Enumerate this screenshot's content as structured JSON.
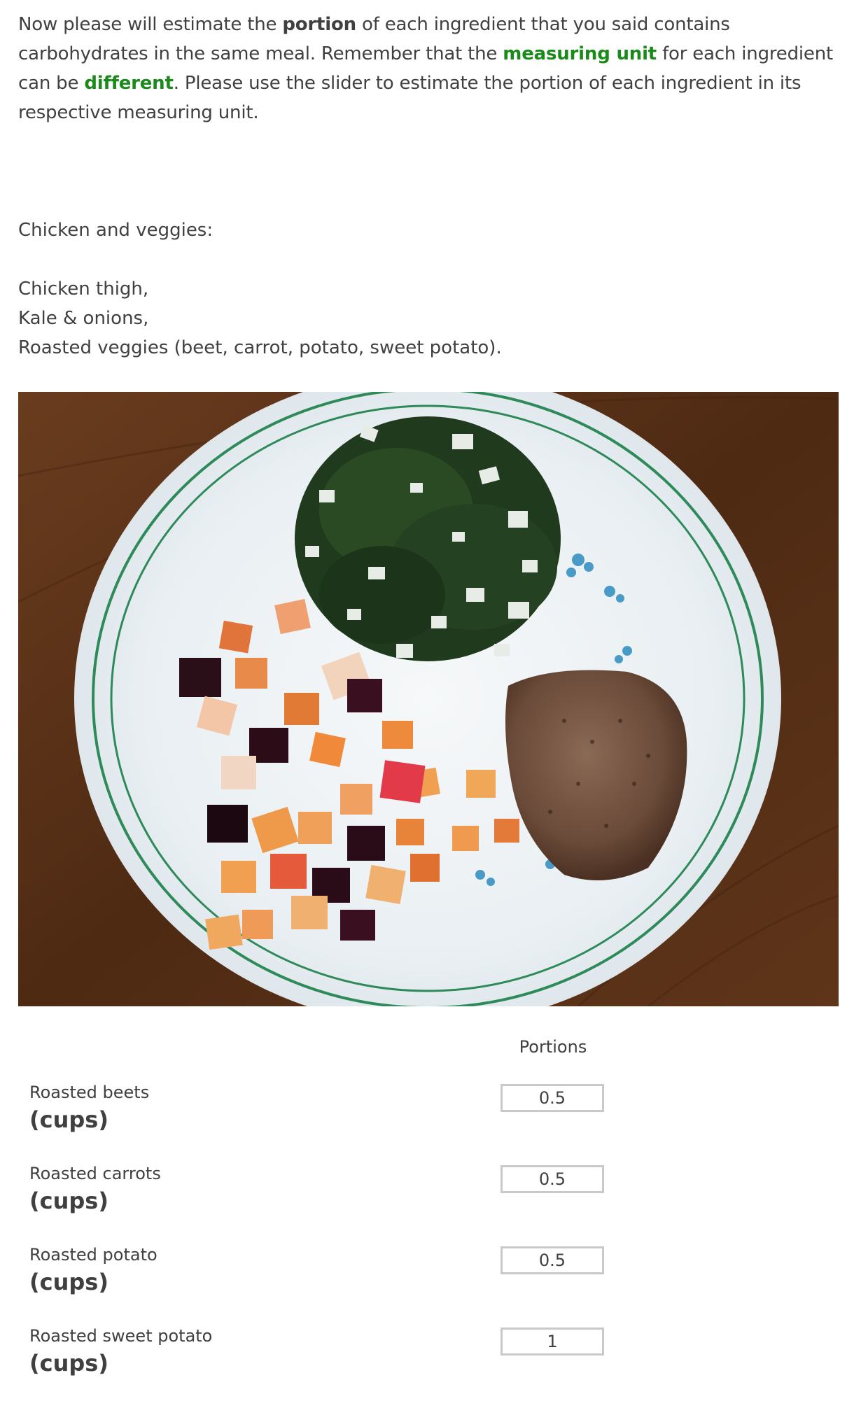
{
  "intro": {
    "part1": "Now please will estimate the ",
    "bold_portion": "portion",
    "part2": " of each ingredient that you said contains carbohydrates in the same meal. Remember that the ",
    "green_measuring_unit": "measuring unit",
    "part3": " for each ingredient can be ",
    "green_different": "different",
    "part4": ". Please use the slider to estimate the portion of each ingredient in its respective measuring unit."
  },
  "meal": {
    "title": "Chicken and veggies:",
    "items": [
      "Chicken thigh,",
      "Kale & onions,",
      "Roasted veggies (beet, carrot, potato, sweet potato)."
    ]
  },
  "table": {
    "column_header": "Portions",
    "rows": [
      {
        "name": "Roasted beets",
        "unit": "(cups)",
        "value": "0.5"
      },
      {
        "name": "Roasted carrots",
        "unit": "(cups)",
        "value": "0.5"
      },
      {
        "name": "Roasted potato",
        "unit": "(cups)",
        "value": "0.5"
      },
      {
        "name": "Roasted sweet potato",
        "unit": "(cups)",
        "value": "1"
      }
    ]
  },
  "colors": {
    "text": "#404040",
    "accent_green": "#1a8a1a",
    "input_border": "#c9c9c9",
    "table_wood": "#5b3218",
    "plate": "#eef3f6",
    "plate_rim_stripe": "#2f8a5a"
  }
}
